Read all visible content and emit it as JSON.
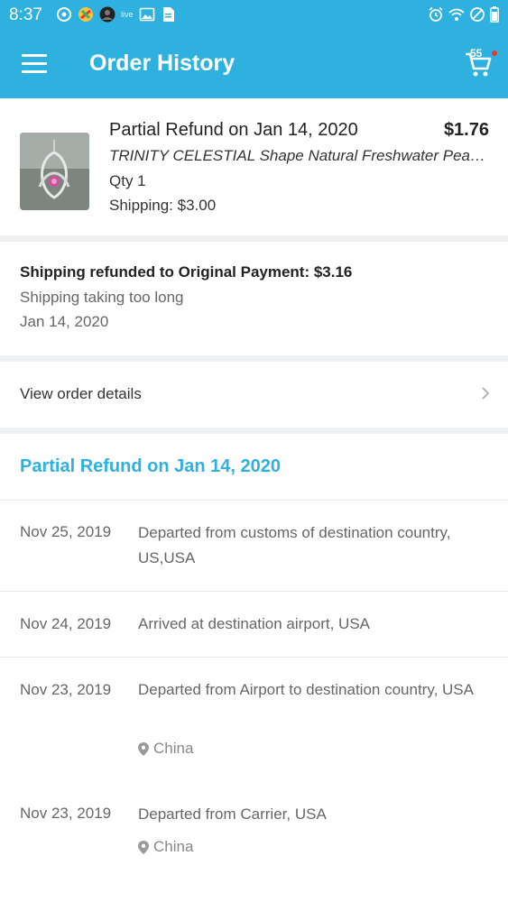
{
  "status_bar": {
    "time": "8:37",
    "left_icons": [
      "sync-icon",
      "app-icon",
      "avatar-icon",
      "live-icon",
      "image-icon",
      "document-icon"
    ],
    "live_label": "live",
    "right_icons": [
      "alarm-icon",
      "wifi-icon",
      "do-not-disturb-icon",
      "battery-icon"
    ]
  },
  "app_bar": {
    "title": "Order History",
    "cart_count": "55"
  },
  "product": {
    "status_title": "Partial Refund on Jan 14, 2020",
    "price": "$1.76",
    "name": "TRINITY CELESTIAL Shape Natural Freshwater Pearl Pendant",
    "quantity": "Qty 1",
    "shipping": "Shipping: $3.00"
  },
  "refund": {
    "headline": "Shipping refunded to Original Payment: $3.16",
    "reason": "Shipping taking too long",
    "date": "Jan 14, 2020"
  },
  "view_details": {
    "label": "View order details"
  },
  "tracking": {
    "section_title": "Partial Refund on Jan 14, 2020",
    "events": [
      {
        "date": "Nov 25, 2019",
        "description": "Departed from customs of destination country, US,USA",
        "location": ""
      },
      {
        "date": "Nov 24, 2019",
        "description": "Arrived at destination airport, USA",
        "location": ""
      },
      {
        "date": "Nov 23, 2019",
        "description": "Departed from Airport to destination country, USA",
        "location": "China"
      },
      {
        "date": "Nov 23, 2019",
        "description": "Departed from Carrier, USA",
        "location": "China"
      }
    ]
  },
  "colors": {
    "brand": "#2fb1df",
    "badge": "#e53935",
    "divider": "#eef0f2"
  }
}
